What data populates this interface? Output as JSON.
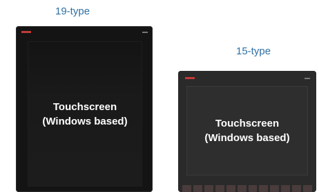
{
  "devices": [
    {
      "type_label": "19-type",
      "screen_text": "Touchscreen\n(Windows based)"
    },
    {
      "type_label": "15-type",
      "screen_text": "Touchscreen\n(Windows based)"
    }
  ],
  "colors": {
    "caption": "#2f6fa3",
    "logo_red": "#c23a3a"
  },
  "icons": [
    "brand-logo-icon"
  ]
}
